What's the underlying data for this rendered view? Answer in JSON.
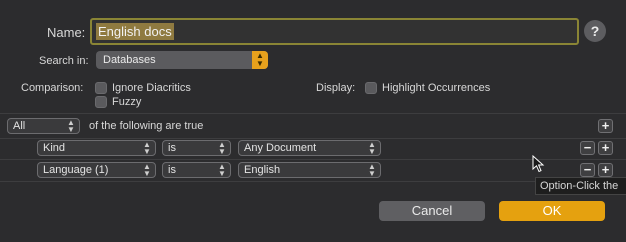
{
  "name": {
    "label": "Name:",
    "value": "English docs",
    "help": "?"
  },
  "search_in": {
    "label": "Search in:",
    "value": "Databases"
  },
  "comparison": {
    "label": "Comparison:",
    "options": [
      "Ignore Diacritics",
      "Fuzzy"
    ]
  },
  "display": {
    "label": "Display:",
    "option": "Highlight Occurrences"
  },
  "match": {
    "value": "All",
    "suffix": "of the following are true"
  },
  "criteria": [
    {
      "field": "Kind",
      "op": "is",
      "value": "Any Document"
    },
    {
      "field": "Language (1)",
      "op": "is",
      "value": "English"
    }
  ],
  "buttons": {
    "plus": "+",
    "minus": "−"
  },
  "tooltip": "Option-Click the",
  "actions": {
    "cancel": "Cancel",
    "ok": "OK"
  },
  "colors": {
    "accent": "#e5a10f",
    "focus_ring": "#8a8535",
    "background": "#2c2c2e"
  }
}
